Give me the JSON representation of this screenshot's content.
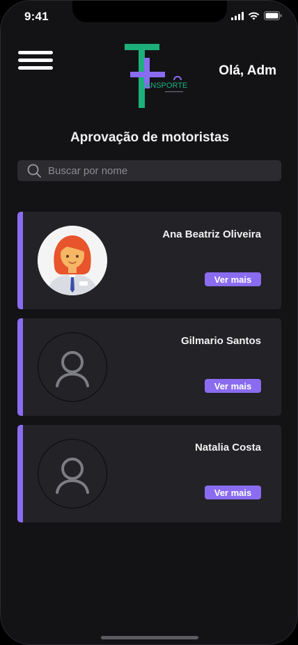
{
  "status_bar": {
    "time": "9:41"
  },
  "header": {
    "logo_text": "RANSPORTE",
    "greeting": "Olá, Adm"
  },
  "page": {
    "title": "Aprovação de motoristas"
  },
  "search": {
    "placeholder": "Buscar por nome"
  },
  "drivers": [
    {
      "name": "Ana Beatriz Oliveira",
      "button_label": "Ver mais",
      "avatar": "woman-avatar-icon"
    },
    {
      "name": "Gilmario Santos",
      "button_label": "Ver mais",
      "avatar": "person-placeholder-icon"
    },
    {
      "name": "Natalia Costa",
      "button_label": "Ver mais",
      "avatar": "person-placeholder-icon"
    }
  ],
  "colors": {
    "background": "#131316",
    "card": "#222227",
    "accent": "#8a6cf0",
    "logo_green": "#1db07a",
    "logo_purple": "#8a6cf0"
  }
}
